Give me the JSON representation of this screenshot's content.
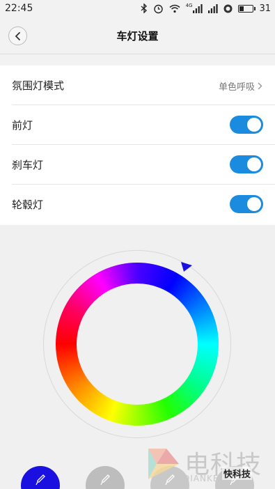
{
  "status_bar": {
    "time": "22:45",
    "network_label": "4G",
    "battery_level": "31",
    "icons": [
      "bluetooth-icon",
      "alarm-icon",
      "wifi-icon",
      "signal-icon",
      "signal-icon",
      "app-notification-icon",
      "battery-icon"
    ]
  },
  "header": {
    "title": "车灯设置",
    "back_icon": "chevron-left-icon"
  },
  "settings": {
    "ambient_mode": {
      "label": "氛围灯模式",
      "value": "单色呼吸"
    },
    "front_light": {
      "label": "前灯",
      "enabled": true
    },
    "brake_light": {
      "label": "刹车灯",
      "enabled": true
    },
    "wheel_light": {
      "label": "轮毂灯",
      "enabled": true
    }
  },
  "colors": {
    "accent": "#1b8be0",
    "selected_swatch": "#1a10e0",
    "inactive_swatch": "#bdbdbd",
    "pointer": "#1a10e0"
  },
  "swatches": [
    {
      "icon": "eyedropper-icon",
      "selected": true
    },
    {
      "icon": "eyedropper-icon",
      "selected": false
    },
    {
      "icon": "eyedropper-icon",
      "selected": false
    },
    {
      "icon": "eyedropper-icon",
      "selected": false
    }
  ],
  "watermark": {
    "title": "电科技",
    "subtitle": "DIANKEJI.COM",
    "brand": "快科技"
  }
}
